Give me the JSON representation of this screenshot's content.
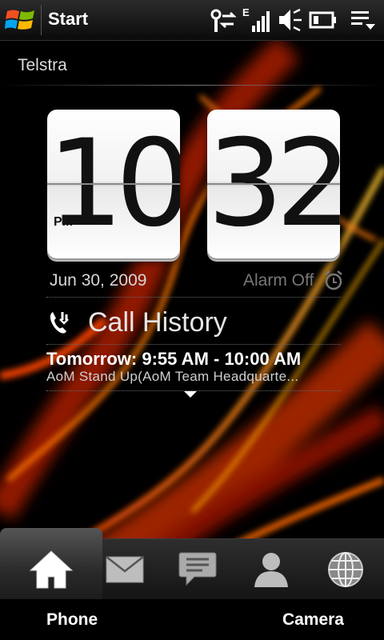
{
  "titlebar": {
    "title": "Start"
  },
  "status": {
    "icons": [
      "antenna-sync-icon",
      "signal-edge-icon",
      "volume-icon",
      "battery-icon",
      "menu-icon"
    ],
    "network_letter": "E"
  },
  "carrier": "Telstra",
  "clock": {
    "hours": "10",
    "minutes": "32",
    "ampm": "PM"
  },
  "date": "Jun 30, 2009",
  "alarm": "Alarm Off",
  "call_history": {
    "label": "Call History",
    "icon": "phone-icon"
  },
  "appointment": {
    "title": "Tomorrow: 9:55 AM - 10:00 AM",
    "subtitle": "AoM Stand Up(AoM Team Headquarte..."
  },
  "tabs": [
    {
      "name": "home",
      "icon": "home-icon"
    },
    {
      "name": "mail",
      "icon": "mail-icon"
    },
    {
      "name": "messages",
      "icon": "message-icon"
    },
    {
      "name": "contacts",
      "icon": "person-icon"
    },
    {
      "name": "internet",
      "icon": "globe-icon"
    }
  ],
  "softkeys": {
    "left": "Phone",
    "right": "Camera"
  },
  "colors": {
    "accent_orange": "#ff5a10",
    "accent_yellow": "#f2b500",
    "background": "#000000"
  }
}
